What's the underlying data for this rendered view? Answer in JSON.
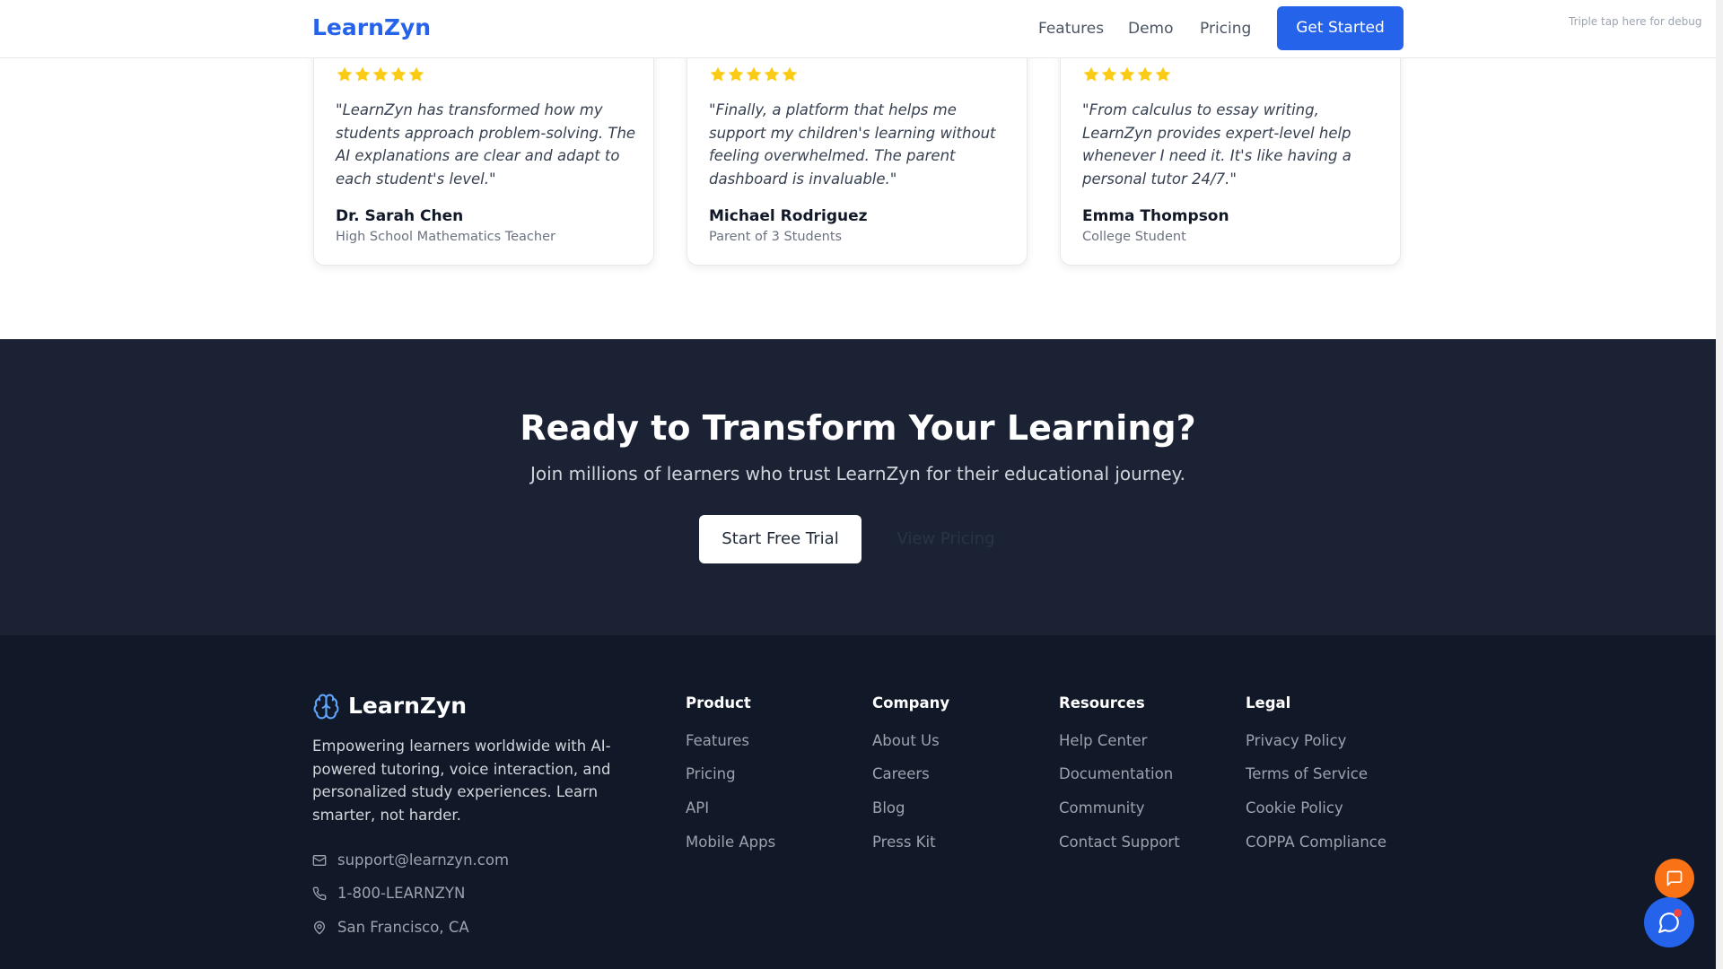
{
  "header": {
    "logo": "LearnZyn",
    "nav": {
      "features": "Features",
      "demo": "Demo",
      "pricing": "Pricing"
    },
    "cta_label": "Get Started",
    "debug_hint": "Triple tap here for debug"
  },
  "testimonials": [
    {
      "rating": 5,
      "quote": "\"LearnZyn has transformed how my students approach problem-solving. The AI explanations are clear and adapt to each student's level.\"",
      "name": "Dr. Sarah Chen",
      "role": "High School Mathematics Teacher"
    },
    {
      "rating": 5,
      "quote": "\"Finally, a platform that helps me support my children's learning without feeling overwhelmed. The parent dashboard is invaluable.\"",
      "name": "Michael Rodriguez",
      "role": "Parent of 3 Students"
    },
    {
      "rating": 5,
      "quote": "\"From calculus to essay writing, LearnZyn provides expert-level help whenever I need it. It's like having a personal tutor 24/7.\"",
      "name": "Emma Thompson",
      "role": "College Student"
    }
  ],
  "cta": {
    "title": "Ready to Transform Your Learning?",
    "subtitle": "Join millions of learners who trust LearnZyn for their educational journey.",
    "primary_label": "Start Free Trial",
    "secondary_label": "View Pricing"
  },
  "footer": {
    "brand": "LearnZyn",
    "brand_icon": "brain-icon",
    "description": "Empowering learners worldwide with AI-powered tutoring, voice interaction, and personalized study experiences. Learn smarter, not harder.",
    "contact": {
      "email": "support@learnzyn.com",
      "phone": "1-800-LEARNZYN",
      "location": "San Francisco, CA"
    },
    "columns": [
      {
        "title": "Product",
        "links": [
          "Features",
          "Pricing",
          "API",
          "Mobile Apps"
        ]
      },
      {
        "title": "Company",
        "links": [
          "About Us",
          "Careers",
          "Blog",
          "Press Kit"
        ]
      },
      {
        "title": "Resources",
        "links": [
          "Help Center",
          "Documentation",
          "Community",
          "Contact Support"
        ]
      },
      {
        "title": "Legal",
        "links": [
          "Privacy Policy",
          "Terms of Service",
          "Cookie Policy",
          "COPPA Compliance"
        ]
      }
    ]
  },
  "floating": {
    "feedback_icon": "message-square-icon",
    "chat_icon": "message-circle-icon",
    "chat_has_notification": true
  },
  "colors": {
    "brand_blue": "#2563eb",
    "star_yellow": "#facc15",
    "cta_background": "#1a2234",
    "footer_background": "#111827",
    "feedback_orange": "#f97316",
    "notification_red": "#ef4444"
  }
}
